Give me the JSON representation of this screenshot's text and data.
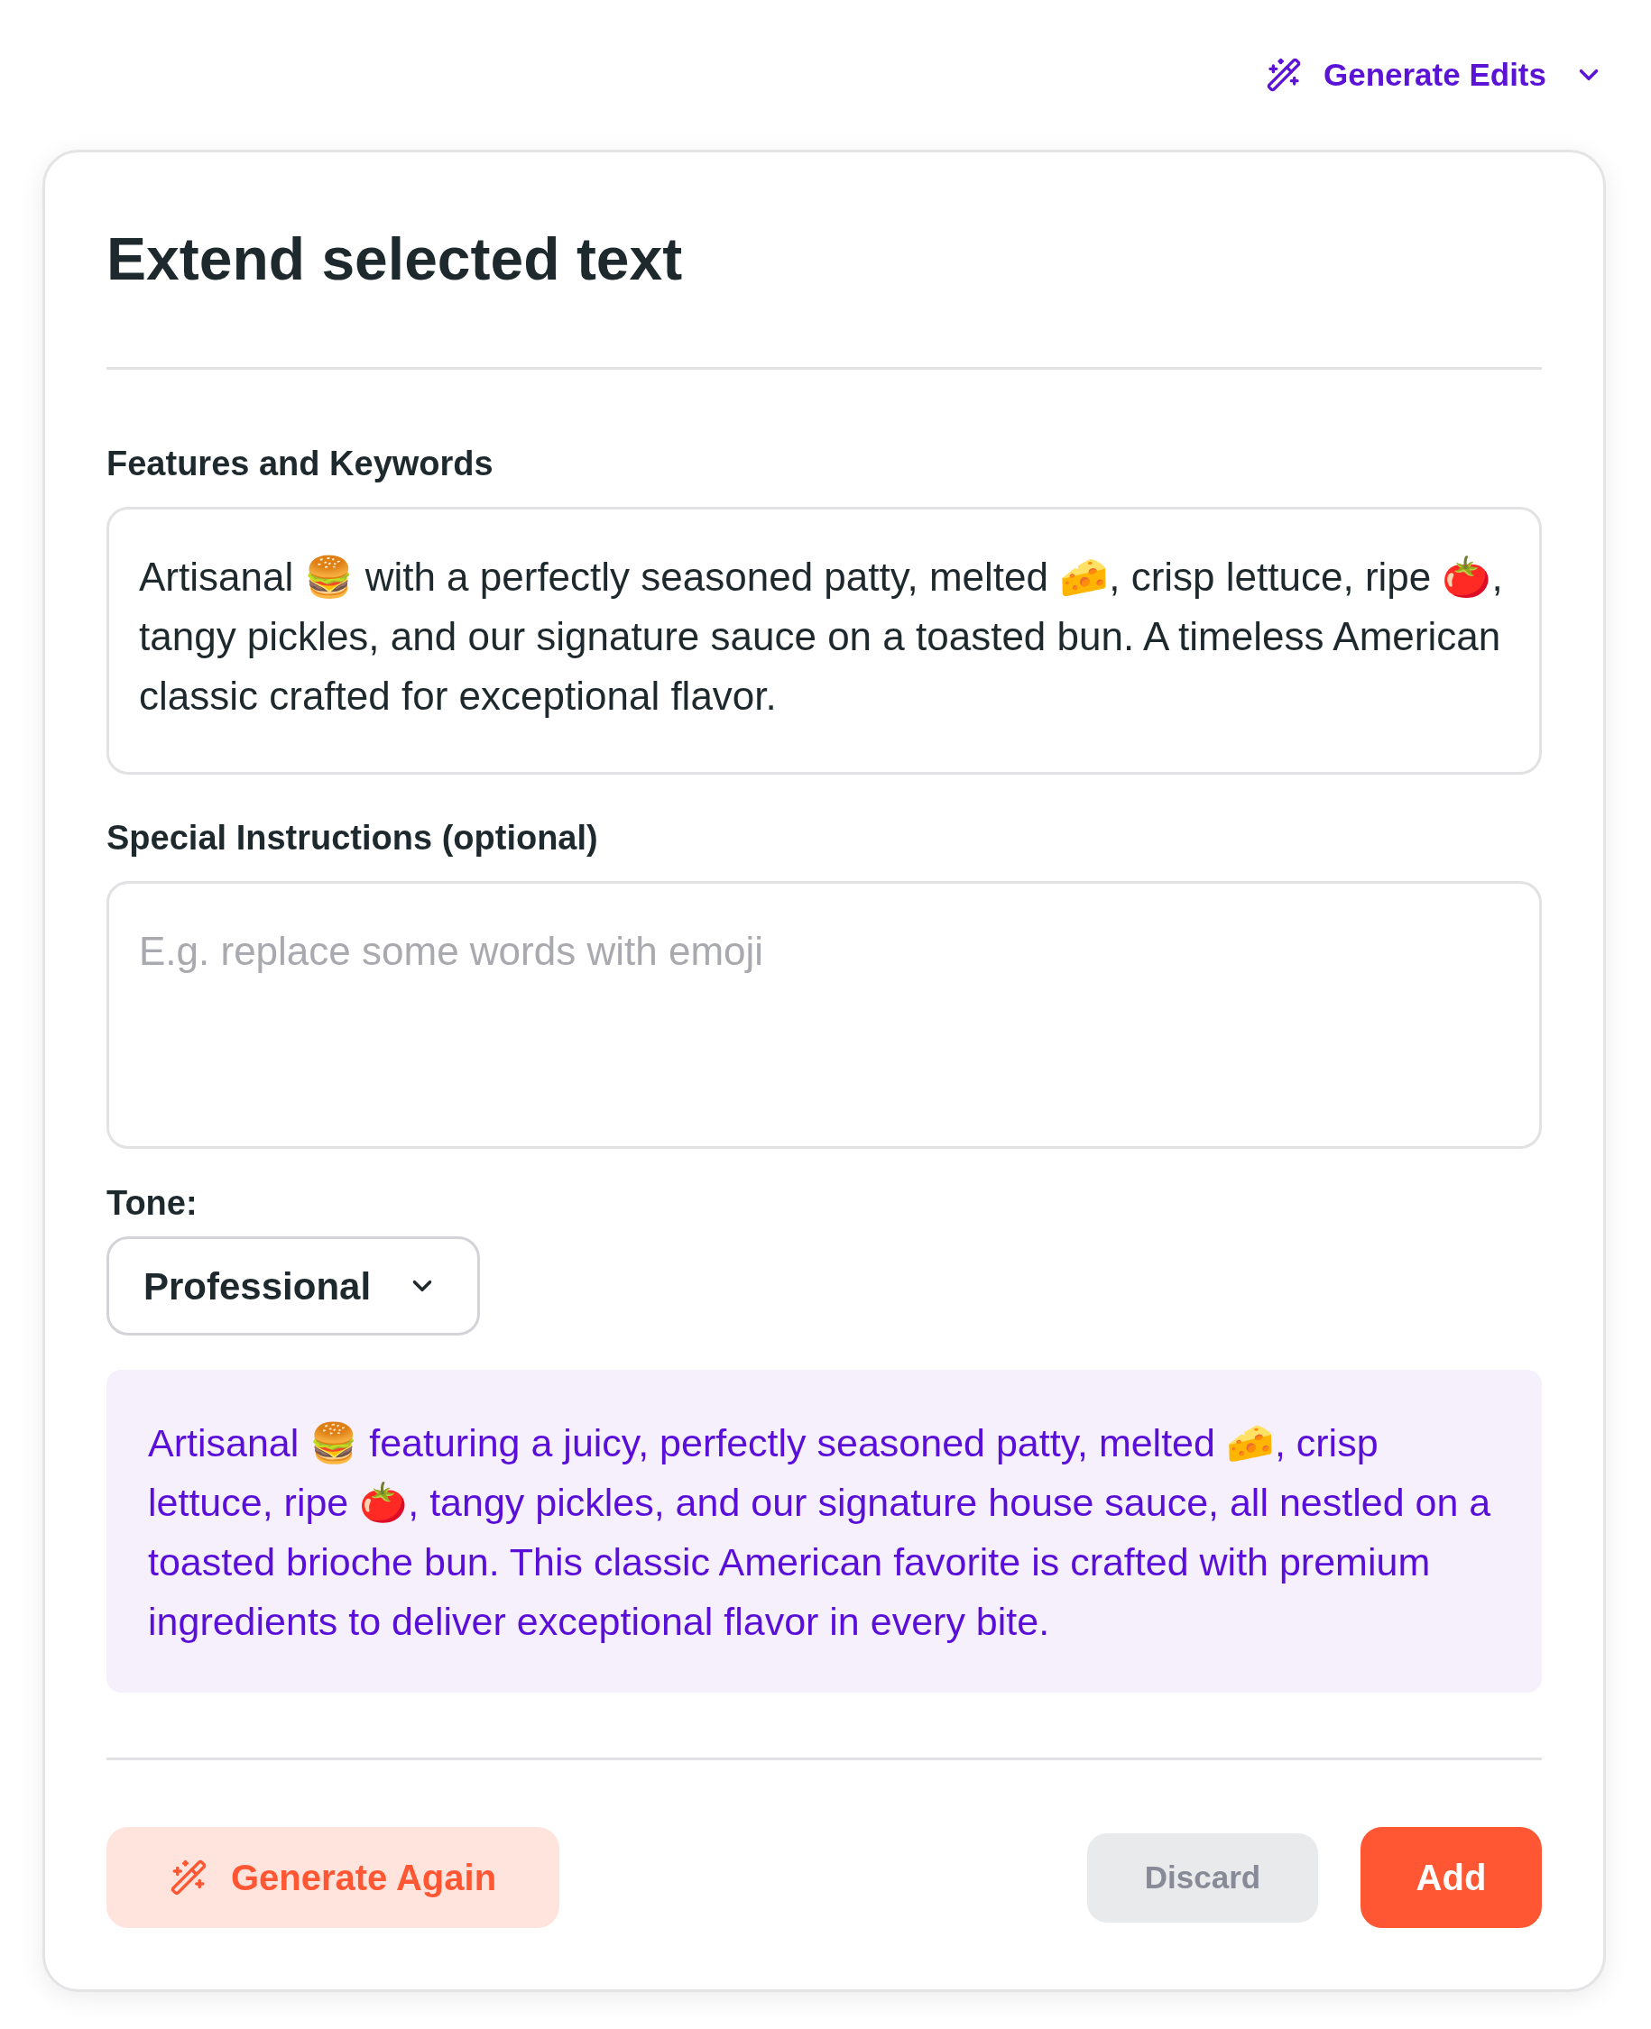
{
  "toolbar": {
    "generate_edits": {
      "label": "Generate Edits",
      "expanded": false
    }
  },
  "dialog": {
    "title": "Extend selected text",
    "fields": [
      {
        "label": "Features and Keywords",
        "value": "Artisanal 🍔 with a perfectly seasoned patty, melted 🧀, crisp lettuce, ripe 🍅, tangy pickles, and our signature sauce on a toasted bun. A timeless American classic crafted for exceptional flavor."
      },
      {
        "label": "Special Instructions (optional)",
        "placeholder": "E.g. replace some words with emoji"
      }
    ],
    "tone": {
      "label": "Tone:",
      "value": "Professional",
      "expanded": false
    },
    "result": {
      "text": "Artisanal 🍔 featuring a juicy, perfectly seasoned patty, melted 🧀, crisp lettuce, ripe 🍅, tangy pickles, and our signature house sauce, all nestled on a toasted brioche bun. This classic American favorite is crafted with premium ingredients to deliver exceptional flavor in every bite."
    },
    "buttons": [
      {
        "kind": "secondary",
        "label": "Generate Again"
      },
      {
        "kind": "neutral",
        "label": "Discard"
      },
      {
        "kind": "primary",
        "label": "Add"
      }
    ]
  }
}
